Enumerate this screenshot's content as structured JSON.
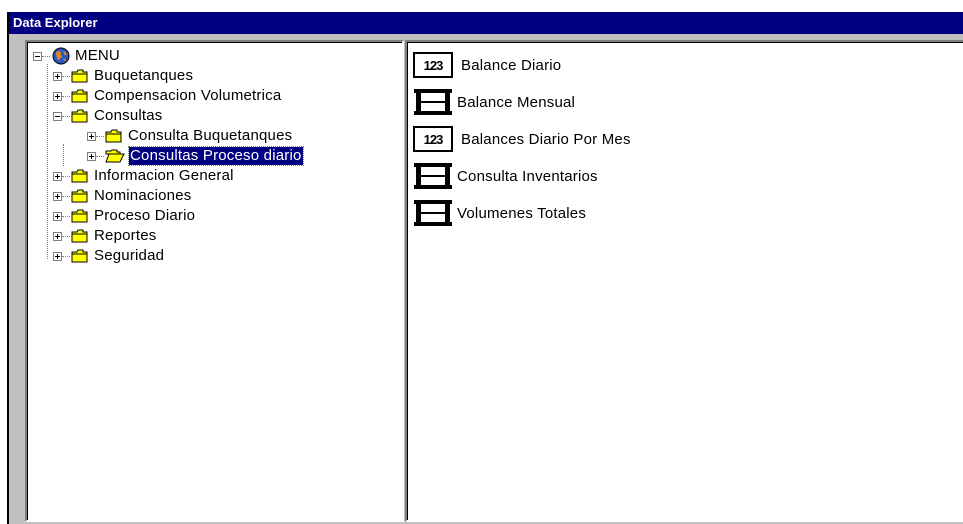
{
  "window": {
    "title": "Data Explorer"
  },
  "tree": {
    "root": {
      "label": "MENU",
      "icon": "globe-icon"
    },
    "items": [
      {
        "label": "Buquetanques",
        "icon": "folder-icon",
        "expander": "plus"
      },
      {
        "label": "Compensacion Volumetrica",
        "icon": "folder-icon",
        "expander": "plus"
      },
      {
        "label": "Consultas",
        "icon": "folder-icon",
        "expander": "minus"
      },
      {
        "label": "Consulta Buquetanques",
        "icon": "folder-icon",
        "expander": "plus"
      },
      {
        "label": "Consultas Proceso diario",
        "icon": "folder-open-icon",
        "expander": "plus",
        "selected": true
      },
      {
        "label": "Informacion General",
        "icon": "folder-icon",
        "expander": "plus"
      },
      {
        "label": "Nominaciones",
        "icon": "folder-icon",
        "expander": "plus"
      },
      {
        "label": "Proceso Diario",
        "icon": "folder-icon",
        "expander": "plus"
      },
      {
        "label": "Reportes",
        "icon": "folder-icon",
        "expander": "plus"
      },
      {
        "label": "Seguridad",
        "icon": "folder-icon",
        "expander": "plus"
      }
    ]
  },
  "list": {
    "items": [
      {
        "label": "Balance Diario",
        "icon": "number-form-icon",
        "icon_text": "123"
      },
      {
        "label": "Balance Mensual",
        "icon": "table-icon"
      },
      {
        "label": "Balances Diario Por Mes",
        "icon": "number-form-icon",
        "icon_text": "123"
      },
      {
        "label": "Consulta Inventarios",
        "icon": "table-icon"
      },
      {
        "label": "Volumenes Totales",
        "icon": "table-icon"
      }
    ]
  },
  "colors": {
    "title_bar": "#000080",
    "selection": "#000080",
    "folder": "#ffff00",
    "window_face": "#c0c0c0"
  }
}
